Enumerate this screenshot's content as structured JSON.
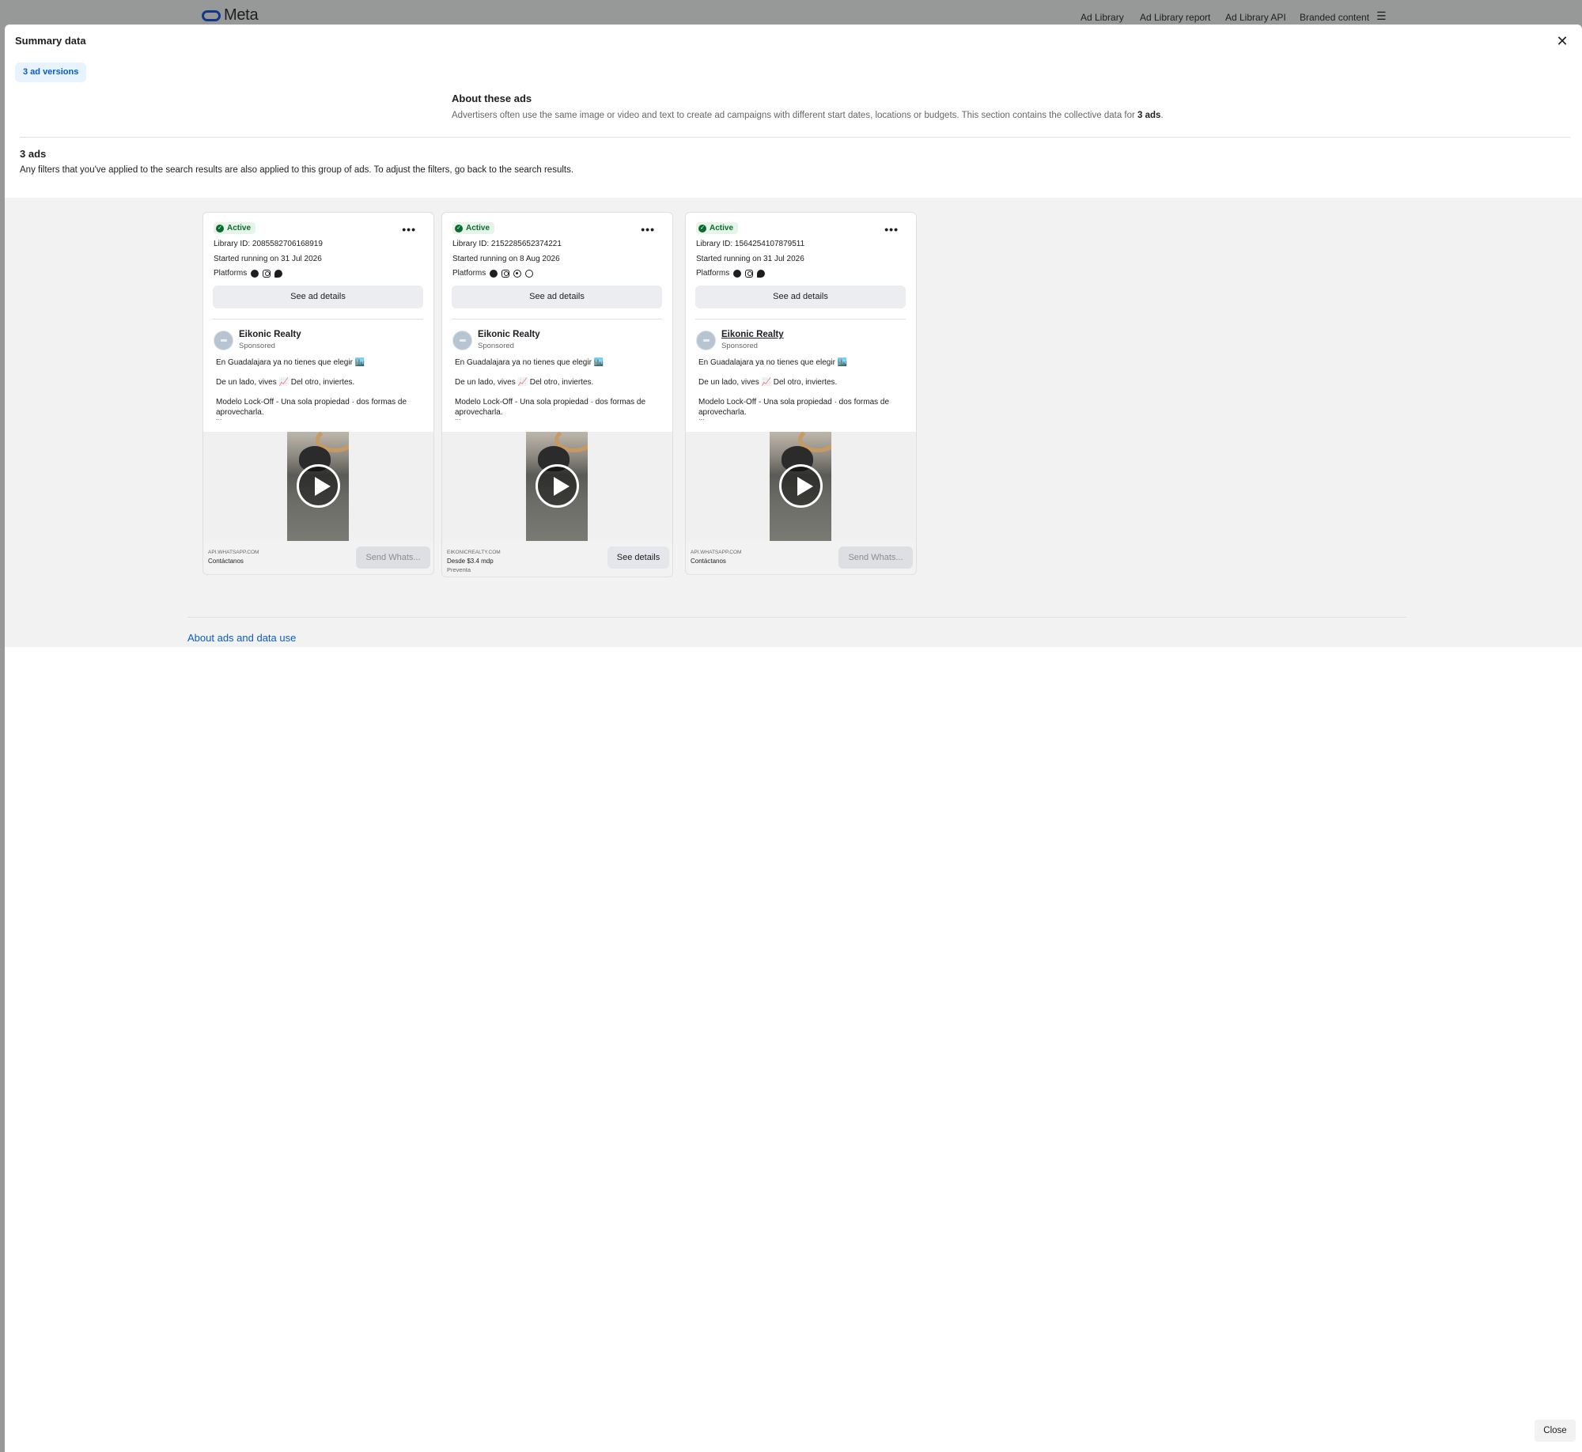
{
  "header": {
    "logo_text": "Meta",
    "nav": [
      {
        "label": "Ad Library"
      },
      {
        "label": "Ad Library report"
      },
      {
        "label": "Ad Library API"
      },
      {
        "label": "Branded content"
      }
    ],
    "menu_icon": "hamburger-icon"
  },
  "modal": {
    "title": "Summary data",
    "close_icon": "close-icon",
    "versions_pill": "3 ad versions",
    "about": {
      "title": "About these ads",
      "text_before": "Advertisers often use the same image or video and text to create ad campaigns with different start dates, locations or budgets. This section contains the collective data for ",
      "text_bold": "3 ads",
      "text_after": "."
    },
    "ads_count": "3 ads",
    "filter_note": "Any filters that you've applied to the search results are also applied to this group of ads. To adjust the filters, go back to the search results.",
    "about_link": "About ads and data use",
    "close_button": "Close"
  },
  "cards": [
    {
      "status": "Active",
      "library_id": "Library ID: 2085582706168919",
      "started": "Started running on 31 Jul 2026",
      "platforms_label": "Platforms",
      "platforms": [
        "facebook-icon",
        "instagram-icon",
        "messenger-icon"
      ],
      "see_ad_details": "See ad details",
      "advertiser": "Eikonic Realty",
      "sponsored": "Sponsored",
      "body": [
        "En Guadalajara ya no tienes que elegir 🏙️",
        "De un lado, vives 📈 Del otro, inviertes.",
        "Modelo Lock-Off - Una sola propiedad · dos formas de aprovecharla."
      ],
      "ellipsis": "...",
      "domain": "API.WHATSAPP.COM",
      "cta_line1": "Contáctanos",
      "cta_line2": "",
      "cta_button": "Send Whats...",
      "cta_disabled": true
    },
    {
      "status": "Active",
      "library_id": "Library ID: 2152285652374221",
      "started": "Started running on 8 Aug 2026",
      "platforms_label": "Platforms",
      "platforms": [
        "facebook-icon",
        "instagram-icon",
        "whatsapp-icon",
        "threads-icon"
      ],
      "see_ad_details": "See ad details",
      "advertiser": "Eikonic Realty",
      "sponsored": "Sponsored",
      "body": [
        "En Guadalajara ya no tienes que elegir 🏙️",
        "De un lado, vives 📈 Del otro, inviertes.",
        "Modelo Lock-Off - Una sola propiedad · dos formas de aprovecharla."
      ],
      "ellipsis": "...",
      "domain": "EIKONICREALTY.COM",
      "cta_line1": "Desde $3.4 mdp",
      "cta_line2": "Preventa",
      "cta_button": "See details",
      "cta_disabled": false
    },
    {
      "status": "Active",
      "library_id": "Library ID: 1564254107879511",
      "started": "Started running on 31 Jul 2026",
      "platforms_label": "Platforms",
      "platforms": [
        "facebook-icon",
        "instagram-icon",
        "messenger-icon"
      ],
      "see_ad_details": "See ad details",
      "advertiser": "Eikonic Realty",
      "sponsored": "Sponsored",
      "body": [
        "En Guadalajara ya no tienes que elegir 🏙️",
        "De un lado, vives 📈 Del otro, inviertes.",
        "Modelo Lock-Off - Una sola propiedad · dos formas de aprovecharla."
      ],
      "ellipsis": "...",
      "domain": "API.WHATSAPP.COM",
      "cta_line1": "Contáctanos",
      "cta_line2": "",
      "cta_button": "Send Whats...",
      "cta_disabled": true
    }
  ]
}
